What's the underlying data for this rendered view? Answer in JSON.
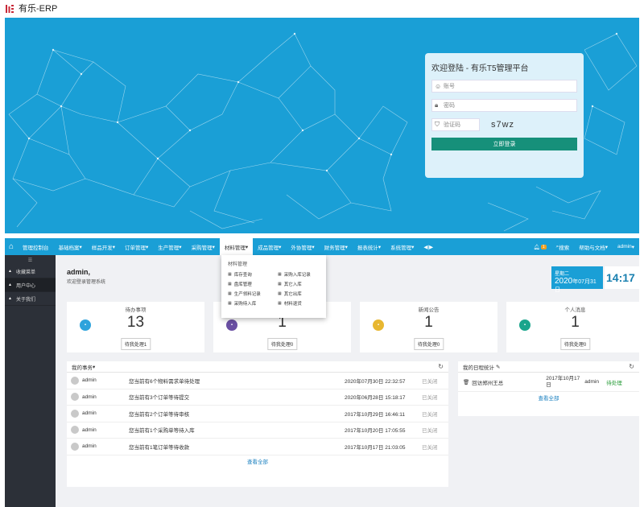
{
  "app_title": "有乐-ERP",
  "colors": {
    "brand": "#1a9fd6",
    "login_button": "#16907a",
    "sidebar": "#2c3038",
    "logo": "#c82837"
  },
  "login": {
    "title": "欢迎登陆 - 有乐T5管理平台",
    "account_placeholder": "账号",
    "password_placeholder": "密码",
    "captcha_placeholder": "验证码",
    "captcha_code": "s7wz",
    "submit_label": "立即登录"
  },
  "nav": {
    "items": [
      "管理控制台",
      "基础档案",
      "样品开发",
      "订单管理",
      "生产管理",
      "采购管理",
      "材料管理",
      "成品管理",
      "外协管理",
      "财务管理",
      "报表统计",
      "系统管理"
    ],
    "arrows": "◀|▶",
    "notification_count": "1",
    "search_label": "搜索",
    "help_label": "帮助与文档",
    "user_label": "admin"
  },
  "dropdown": {
    "title": "材料管理",
    "items": [
      "库存查询",
      "采购入库记录",
      "盘库管理",
      "其它入库",
      "生产领料记录",
      "其它出库",
      "采购待入库",
      "材料退货"
    ]
  },
  "sidebar": {
    "toggle": "☰",
    "items": [
      "收藏菜单",
      "用户中心",
      "关于我们"
    ]
  },
  "welcome": {
    "name": "admin,",
    "sub": "欢迎登录管理系统"
  },
  "date": {
    "weekday": "星期二",
    "year": "2020",
    "month_day": "年07月31日",
    "time": "14:17"
  },
  "stats": [
    {
      "title": "待办事项",
      "value": "13",
      "button": "待我处理1",
      "color": "#2ea3dc"
    },
    {
      "title": "",
      "value": "1",
      "button": "待我处理0",
      "color": "#6a4fa3"
    },
    {
      "title": "新闻公告",
      "value": "1",
      "button": "待我处理0",
      "color": "#e8b730"
    },
    {
      "title": "个人消息",
      "value": "1",
      "button": "待我处理0",
      "color": "#1aa58c"
    }
  ],
  "tasks": {
    "title": "我的事务",
    "rows": [
      {
        "user": "admin",
        "message": "您当前有6个物料需求单待处理",
        "time": "2020年07月30日 22:32:57",
        "status": "已关闭"
      },
      {
        "user": "admin",
        "message": "您当前有3个订单等待提交",
        "time": "2020年06月28日 15:18:17",
        "status": "已关闭"
      },
      {
        "user": "admin",
        "message": "您当前有2个订单等待审核",
        "time": "2017年10月29日 16:46:11",
        "status": "已关闭"
      },
      {
        "user": "admin",
        "message": "您当前有1个采购单等待入库",
        "time": "2017年10月20日 17:05:55",
        "status": "已关闭"
      },
      {
        "user": "admin",
        "message": "您当前有1笔订单等待收款",
        "time": "2017年10月17日 21:03:05",
        "status": "已关闭"
      }
    ],
    "view_all": "查看全部"
  },
  "schedule": {
    "title": "我的日程统计",
    "rows": [
      {
        "task": "回访郑州王总",
        "date": "2017年10月17日",
        "user": "admin",
        "status": "待处理"
      }
    ],
    "view_all": "查看全部"
  }
}
